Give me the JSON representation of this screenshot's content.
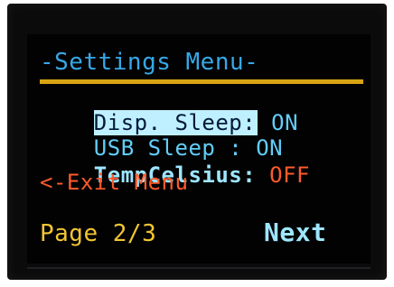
{
  "menu": {
    "title": "-Settings Menu-",
    "items": [
      {
        "label": "Disp. Sleep:",
        "value": " ON",
        "selected": true
      },
      {
        "label": "USB Sleep : ",
        "value": "ON",
        "selected": false
      },
      {
        "label": "TempCelsius: ",
        "value": "OFF",
        "selected": false
      }
    ],
    "exit_label": "<-Exit Menu"
  },
  "footer": {
    "page_indicator": "Page 2/3",
    "next_label": "Next"
  },
  "colors": {
    "title": "#37a8e6",
    "rule": "#d8a414",
    "highlight_bg": "#bff0ff",
    "item_text": "#62cdf6",
    "off_value": "#ff5a2a",
    "exit_text": "#ff5a2a",
    "footer_yellow": "#f2c632",
    "next_text": "#9ee6ff"
  }
}
